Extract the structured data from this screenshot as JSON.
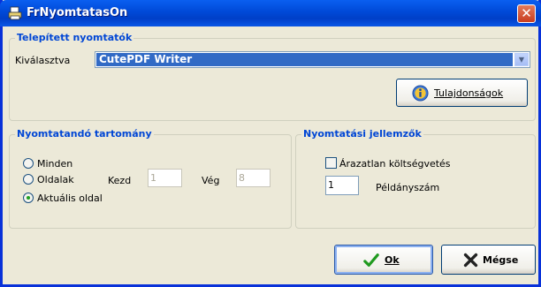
{
  "window": {
    "title": "FrNyomtatasOn",
    "close_label": "✕"
  },
  "printers": {
    "group_title": "Telepített nyomtatók",
    "selected_label": "Kiválasztva",
    "selected_value": "CutePDF Writer",
    "properties_button": "Tulajdonságok"
  },
  "range": {
    "group_title": "Nyomtatandó tartomány",
    "options": [
      "Minden",
      "Oldalak",
      "Aktuális oldal"
    ],
    "selected_option": "Aktuális oldal",
    "start_label": "Kezd",
    "start_value": "1",
    "end_label": "Vég",
    "end_value": "8"
  },
  "properties": {
    "group_title": "Nyomtatási jellemzők",
    "checkbox_label": "Árazatlan költségvetés",
    "checkbox_checked": false,
    "copies_value": "1",
    "copies_label": "Példányszám"
  },
  "buttons": {
    "ok": "Ok",
    "cancel": "Mégse"
  },
  "colors": {
    "title_bar": "#0055e5",
    "group_title": "#0046d5",
    "selection": "#316ac5",
    "ok_icon": "#1f9a1f",
    "cancel_icon": "#222222"
  }
}
